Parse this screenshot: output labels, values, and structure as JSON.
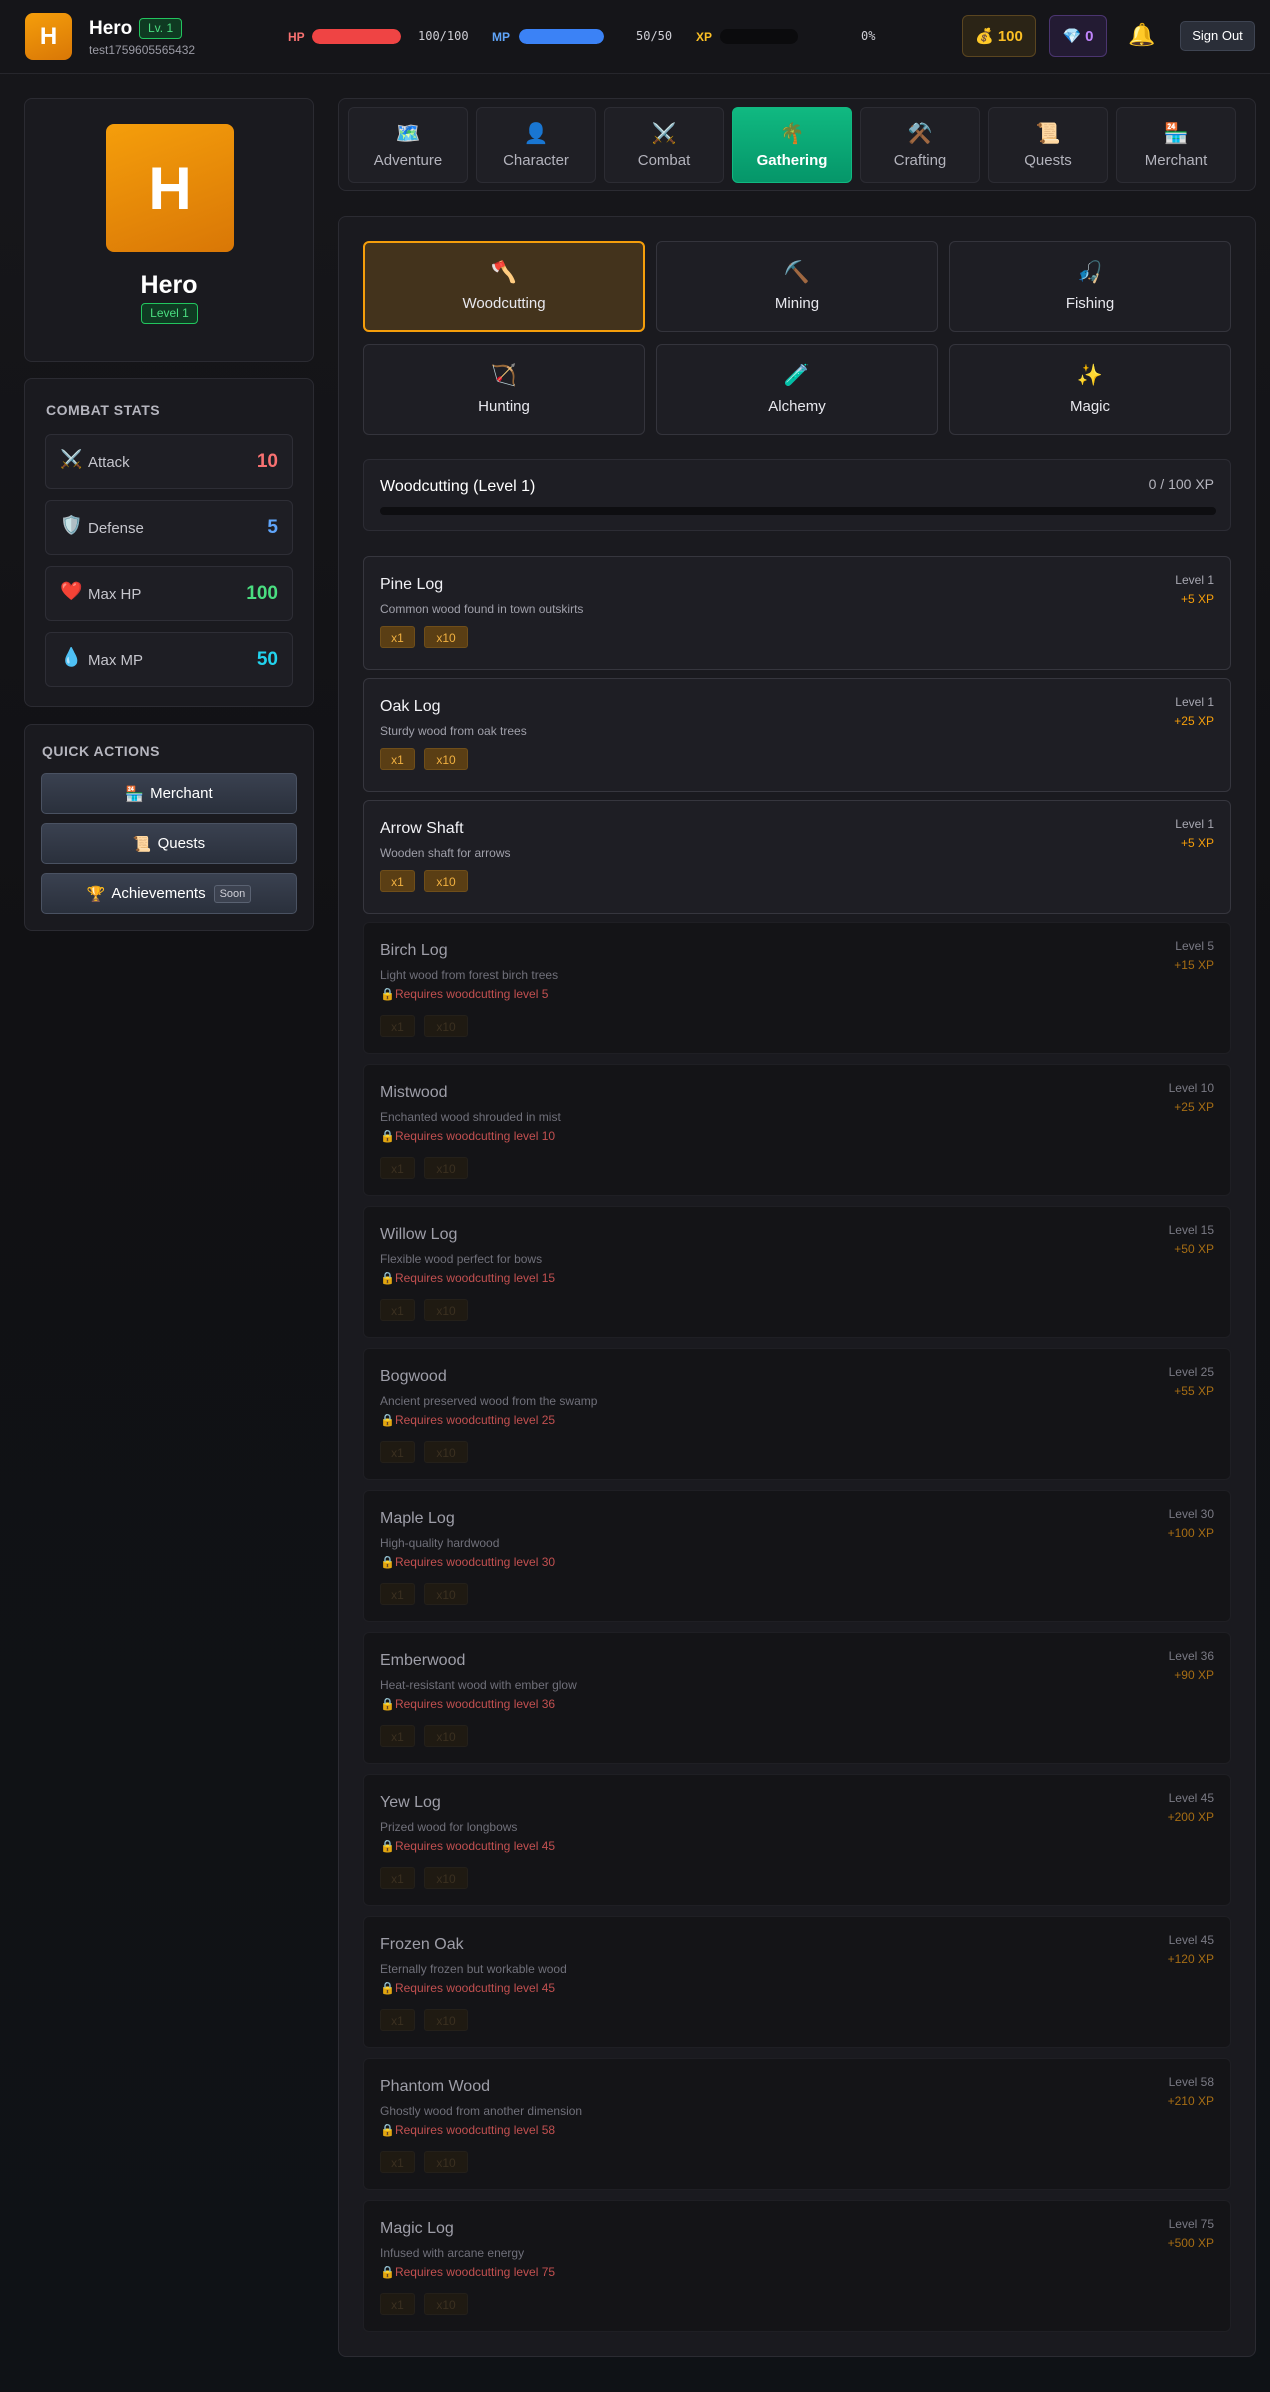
{
  "header": {
    "avatar_letter": "H",
    "player_name": "Hero",
    "level_badge": "Lv. 1",
    "username": "test1759605565432",
    "hp": {
      "label": "HP",
      "value": "100/100",
      "fraction": 1.0,
      "color": "#ef4444"
    },
    "mp": {
      "label": "MP",
      "value": "50/50",
      "fraction": 1.0,
      "color": "#3b82f6"
    },
    "xp": {
      "label": "XP",
      "value": "0%",
      "fraction": 0.0,
      "color": "#f59e0b"
    },
    "gold": {
      "icon": "money-bag-icon",
      "glyph": "💰",
      "value": "100"
    },
    "gems": {
      "icon": "gem-icon",
      "glyph": "💎",
      "value": "0"
    },
    "bell_glyph": "🔔",
    "sign_out_label": "Sign Out"
  },
  "profile": {
    "avatar_letter": "H",
    "name": "Hero",
    "level": "Level 1"
  },
  "combat_stats": {
    "title": "COMBAT STATS",
    "stats": [
      {
        "icon": "crossed-swords-icon",
        "glyph": "⚔️",
        "name": "Attack",
        "value": "10",
        "color": "#f87171"
      },
      {
        "icon": "shield-icon",
        "glyph": "🛡️",
        "name": "Defense",
        "value": "5",
        "color": "#60a5fa"
      },
      {
        "icon": "heart-icon",
        "glyph": "❤️",
        "name": "Max HP",
        "value": "100",
        "color": "#4ade80"
      },
      {
        "icon": "droplet-icon",
        "glyph": "💧",
        "name": "Max MP",
        "value": "50",
        "color": "#22d3ee"
      }
    ]
  },
  "quick_actions": {
    "title": "QUICK ACTIONS",
    "buttons": [
      {
        "icon": "merchant-icon",
        "glyph": "🏪",
        "label": "Merchant"
      },
      {
        "icon": "scroll-icon",
        "glyph": "📜",
        "label": "Quests"
      },
      {
        "icon": "trophy-icon",
        "glyph": "🏆",
        "label": "Achievements",
        "badge": "Soon"
      }
    ]
  },
  "nav_tabs": [
    {
      "icon": "map-icon",
      "glyph": "🗺️",
      "label": "Adventure",
      "active": false
    },
    {
      "icon": "person-icon",
      "glyph": "👤",
      "label": "Character",
      "active": false
    },
    {
      "icon": "crossed-swords-icon",
      "glyph": "⚔️",
      "label": "Combat",
      "active": false
    },
    {
      "icon": "palm-tree-icon",
      "glyph": "🌴",
      "label": "Gathering",
      "active": true
    },
    {
      "icon": "hammer-pick-icon",
      "glyph": "⚒️",
      "label": "Crafting",
      "active": false
    },
    {
      "icon": "scroll-icon",
      "glyph": "📜",
      "label": "Quests",
      "active": false
    },
    {
      "icon": "merchant-icon",
      "glyph": "🏪",
      "label": "Merchant",
      "active": false
    }
  ],
  "skills": [
    {
      "icon": "axe-icon",
      "glyph": "🪓",
      "label": "Woodcutting",
      "active": true
    },
    {
      "icon": "pick-icon",
      "glyph": "⛏️",
      "label": "Mining",
      "active": false
    },
    {
      "icon": "fishing-icon",
      "glyph": "🎣",
      "label": "Fishing",
      "active": false
    },
    {
      "icon": "bow-icon",
      "glyph": "🏹",
      "label": "Hunting",
      "active": false
    },
    {
      "icon": "test-tube-icon",
      "glyph": "🧪",
      "label": "Alchemy",
      "active": false
    },
    {
      "icon": "sparkles-icon",
      "glyph": "✨",
      "label": "Magic",
      "active": false
    }
  ],
  "skill_progress": {
    "title": "Woodcutting (Level 1)",
    "xp": "0 / 100 XP",
    "fraction": 0.0
  },
  "qty_labels": [
    "x1",
    "x10"
  ],
  "lock_glyph": "🔒",
  "items": [
    {
      "name": "Pine Log",
      "desc": "Common wood found in town outskirts",
      "level": "Level 1",
      "xp": "+5 XP",
      "locked": false
    },
    {
      "name": "Oak Log",
      "desc": "Sturdy wood from oak trees",
      "level": "Level 1",
      "xp": "+25 XP",
      "locked": false
    },
    {
      "name": "Arrow Shaft",
      "desc": "Wooden shaft for arrows",
      "level": "Level 1",
      "xp": "+5 XP",
      "locked": false
    },
    {
      "name": "Birch Log",
      "desc": "Light wood from forest birch trees",
      "level": "Level 5",
      "xp": "+15 XP",
      "locked": true,
      "requirement": "Requires woodcutting level 5"
    },
    {
      "name": "Mistwood",
      "desc": "Enchanted wood shrouded in mist",
      "level": "Level 10",
      "xp": "+25 XP",
      "locked": true,
      "requirement": "Requires woodcutting level 10"
    },
    {
      "name": "Willow Log",
      "desc": "Flexible wood perfect for bows",
      "level": "Level 15",
      "xp": "+50 XP",
      "locked": true,
      "requirement": "Requires woodcutting level 15"
    },
    {
      "name": "Bogwood",
      "desc": "Ancient preserved wood from the swamp",
      "level": "Level 25",
      "xp": "+55 XP",
      "locked": true,
      "requirement": "Requires woodcutting level 25"
    },
    {
      "name": "Maple Log",
      "desc": "High-quality hardwood",
      "level": "Level 30",
      "xp": "+100 XP",
      "locked": true,
      "requirement": "Requires woodcutting level 30"
    },
    {
      "name": "Emberwood",
      "desc": "Heat-resistant wood with ember glow",
      "level": "Level 36",
      "xp": "+90 XP",
      "locked": true,
      "requirement": "Requires woodcutting level 36"
    },
    {
      "name": "Yew Log",
      "desc": "Prized wood for longbows",
      "level": "Level 45",
      "xp": "+200 XP",
      "locked": true,
      "requirement": "Requires woodcutting level 45"
    },
    {
      "name": "Frozen Oak",
      "desc": "Eternally frozen but workable wood",
      "level": "Level 45",
      "xp": "+120 XP",
      "locked": true,
      "requirement": "Requires woodcutting level 45"
    },
    {
      "name": "Phantom Wood",
      "desc": "Ghostly wood from another dimension",
      "level": "Level 58",
      "xp": "+210 XP",
      "locked": true,
      "requirement": "Requires woodcutting level 58"
    },
    {
      "name": "Magic Log",
      "desc": "Infused with arcane energy",
      "level": "Level 75",
      "xp": "+500 XP",
      "locked": true,
      "requirement": "Requires woodcutting level 75"
    }
  ]
}
